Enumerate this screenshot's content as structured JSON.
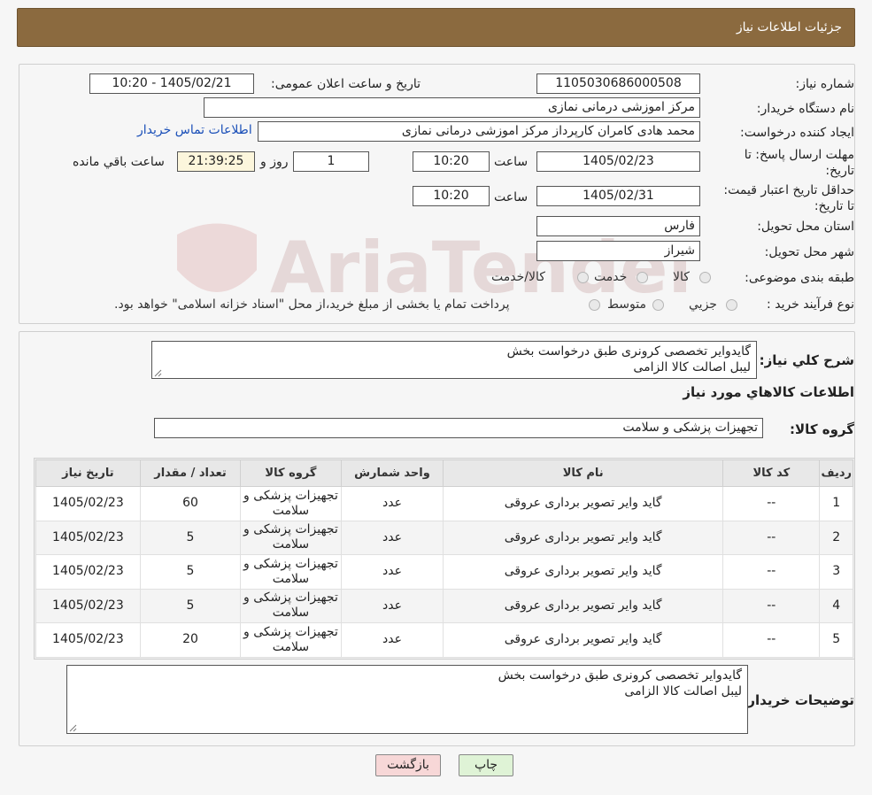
{
  "header": {
    "title": "جزئیات اطلاعات نیاز"
  },
  "watermark": {
    "text": "AriaTender.neT"
  },
  "form": {
    "need_number_label": "شماره نیاز:",
    "need_number": "1105030686000508",
    "announce_label": "تاریخ و ساعت اعلان عمومی:",
    "announce_value": "1405/02/21 - 10:20",
    "buyer_org_label": "نام دستگاه خریدار:",
    "buyer_org": "مرکز اموزشی درمانی نمازی",
    "creator_label": "ایجاد کننده درخواست:",
    "creator": "محمد هادی کامران کارپرداز مرکز اموزشی درمانی نمازی",
    "contact_link": "اطلاعات تماس خریدار",
    "deadline_label": "مهلت ارسال پاسخ: تا تاریخ:",
    "deadline_date": "1405/02/23",
    "time_label": "ساعت",
    "deadline_time": "10:20",
    "days_value": "1",
    "days_label": "روز و",
    "remaining_time": "21:39:25",
    "remaining_label": "ساعت باقي مانده",
    "price_validity_label": "حداقل تاریخ اعتبار قیمت: تا تاریخ:",
    "price_validity_date": "1405/02/31",
    "price_validity_time": "10:20",
    "province_label": "استان محل تحویل:",
    "province": "فارس",
    "city_label": "شهر محل تحویل:",
    "city": "شیراز",
    "category_label": "طبقه بندی موضوعی:",
    "category_options": [
      "کالا",
      "خدمت",
      "کالا/خدمت"
    ],
    "process_label": "نوع فرآیند خرید :",
    "process_options": [
      "جزیي",
      "متوسط"
    ],
    "process_note": "پرداخت تمام یا بخشی از مبلغ خرید،از محل \"اسناد خزانه اسلامی\" خواهد بود."
  },
  "details": {
    "description_label": "شرح کلي نیاز:",
    "description_line1": "گایدوایر تخصصی کرونری طبق درخواست بخش",
    "description_line2": "لیبل اصالت کالا الزامی",
    "items_heading": "اطلاعات کالاهاي مورد نیاز",
    "group_label": "گروه کالا:",
    "group_value": "تجهیزات پزشکی و سلامت",
    "table": {
      "headers": [
        "ردیف",
        "کد کالا",
        "نام کالا",
        "واحد شمارش",
        "گروه کالا",
        "تعداد / مقدار",
        "تاریخ نیاز"
      ],
      "rows": [
        {
          "idx": "1",
          "code": "--",
          "name": "گاید وایر تصویر برداری عروقی",
          "unit": "عدد",
          "group": "تجهیزات پزشکی و سلامت",
          "qty": "60",
          "date": "1405/02/23"
        },
        {
          "idx": "2",
          "code": "--",
          "name": "گاید وایر تصویر برداری عروقی",
          "unit": "عدد",
          "group": "تجهیزات پزشکی و سلامت",
          "qty": "5",
          "date": "1405/02/23"
        },
        {
          "idx": "3",
          "code": "--",
          "name": "گاید وایر تصویر برداری عروقی",
          "unit": "عدد",
          "group": "تجهیزات پزشکی و سلامت",
          "qty": "5",
          "date": "1405/02/23"
        },
        {
          "idx": "4",
          "code": "--",
          "name": "گاید وایر تصویر برداری عروقی",
          "unit": "عدد",
          "group": "تجهیزات پزشکی و سلامت",
          "qty": "5",
          "date": "1405/02/23"
        },
        {
          "idx": "5",
          "code": "--",
          "name": "گاید وایر تصویر برداری عروقی",
          "unit": "عدد",
          "group": "تجهیزات پزشکی و سلامت",
          "qty": "20",
          "date": "1405/02/23"
        }
      ]
    },
    "buyer_notes_label": "توضیحات خریدار:",
    "buyer_notes_line1": "گایدوایر تخصصی کرونری طبق درخواست بخش",
    "buyer_notes_line2": "لیبل اصالت کالا الزامی"
  },
  "buttons": {
    "print": "چاپ",
    "back": "بازگشت"
  },
  "colors": {
    "header": "#8b6a3f",
    "link": "#1a4fb8",
    "back_button": "#f7d7d7",
    "print_button": "#dff3d6"
  }
}
